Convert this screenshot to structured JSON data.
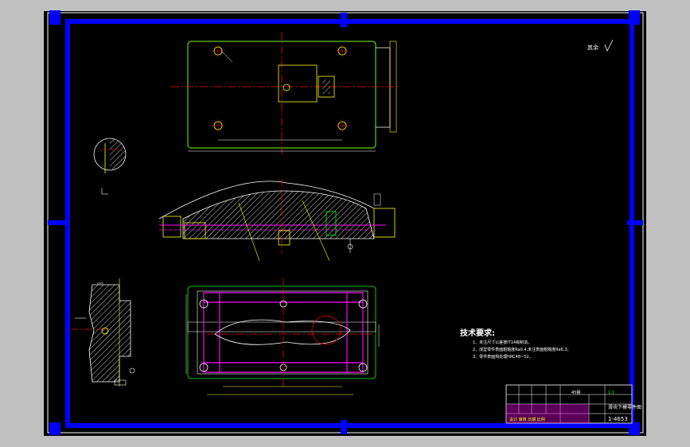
{
  "drawing": {
    "title_heading": "技术要求:",
    "requirements": [
      "1、未注尺寸公差按IT14级制造。",
      "2、成型零件表面粗糙度Ra0.4,未注表面粗糙度Ra6.3。",
      "3、零件表面热处理HRC48~52。"
    ],
    "roughness_label": "其余",
    "title_block": {
      "part_name": "滑块下模零件图",
      "code": "1-4653",
      "material": "45钢",
      "scale": "1:1",
      "school_label": "设计 审核 日期 比例"
    }
  },
  "colors": {
    "background": "#000000",
    "frame": "#0000ff",
    "outline": "#ffffff",
    "part": "#ffff00",
    "centerline": "#ff0000",
    "hidden": "#ff00ff",
    "section": "#ffffff",
    "dimension": "#00ff00"
  }
}
